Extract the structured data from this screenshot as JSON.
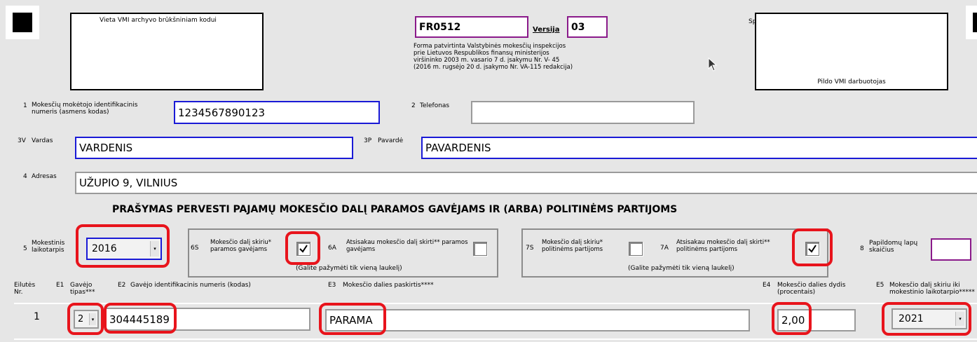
{
  "header": {
    "barcode_label": "Vieta VMI archyvo brūkšniniam kodui",
    "form_code": "FR0512",
    "version_label": "Versija",
    "version_value": "03",
    "approval": [
      "Forma patvirtinta Valstybinės mokesčių inspekcijos",
      "prie Lietuvos Respublikos finansų ministerijos",
      "viršininko 2003 m. vasario 7 d. įsakymu Nr. V- 45",
      "(2016 m. rugsėjo 20 d. įsakymo Nr. VA-115 redakcija)"
    ],
    "stamp_label": "Spaudas",
    "stamp_footer": "Pildo VMI darbuotojas"
  },
  "fields": {
    "f1_num": "1",
    "f1_label": "Mokesčių mokėtojo identifikacinis numeris (asmens kodas)",
    "f1_value": "1234567890123",
    "f2_num": "2",
    "f2_label": "Telefonas",
    "f2_value": "",
    "f3v_num": "3V",
    "f3v_label": "Vardas",
    "f3v_value": "VARDENIS",
    "f3p_num": "3P",
    "f3p_label": "Pavardė",
    "f3p_value": "PAVARDENIS",
    "f4_num": "4",
    "f4_label": "Adresas",
    "f4_value": "UŽUPIO 9, VILNIUS"
  },
  "title": "PRAŠYMAS PERVESTI PAJAMŲ MOKESČIO DALĮ PARAMOS GAVĖJAMS IR (ARBA) POLITINĖMS PARTIJOMS",
  "section5": {
    "num": "5",
    "label": "Mokestinis laikotarpis",
    "value": "2016",
    "g1": {
      "s_num": "6S",
      "s_label": "Mokesčio dalį skiriu* paramos gavėjams",
      "s_checked": true,
      "a_num": "6A",
      "a_label": "Atsisakau mokesčio dalį skirti** paramos gavėjams",
      "a_checked": false,
      "note": "(Galite pažymėti tik vieną laukelį)"
    },
    "g2": {
      "s_num": "7S",
      "s_label": "Mokesčio dalį skiriu* politinėms partijoms",
      "s_checked": false,
      "a_num": "7A",
      "a_label": "Atsisakau mokesčio dalį skirti** politinėms partijoms",
      "a_checked": true,
      "note": "(Galite pažymėti tik vieną laukelį)"
    },
    "f8_num": "8",
    "f8_label": "Papildomų lapų skaičius",
    "f8_value": ""
  },
  "table": {
    "row_header": "Eilutės Nr.",
    "e1_code": "E1",
    "e1_label": "Gavėjo tipas***",
    "e2_code": "E2",
    "e2_label": "Gavėjo identifikacinis numeris (kodas)",
    "e3_code": "E3",
    "e3_label": "Mokesčio dalies paskirtis****",
    "e4_code": "E4",
    "e4_label": "Mokesčio dalies dydis (procentais)",
    "e5_code": "E5",
    "e5_label": "Mokesčio dalį skiriu iki mokestinio laikotarpio*****",
    "rows": [
      {
        "nr": "1",
        "type": "2",
        "code": "304445189",
        "purpose": "PARAMA",
        "percent": "2,00",
        "until": "2021"
      }
    ]
  },
  "colors": {
    "highlight": "#e8141c",
    "field_border": "#1a1ad6",
    "code_border": "#8a1a8a"
  },
  "icons": [
    "checkmark-icon",
    "chevron-down-icon",
    "mouse-cursor-icon"
  ]
}
